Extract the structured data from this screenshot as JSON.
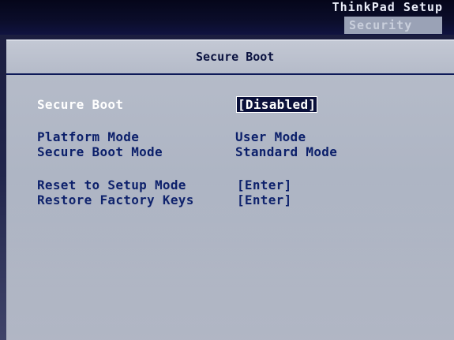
{
  "header": {
    "app_title": "ThinkPad Setup",
    "active_tab": "Security"
  },
  "panel": {
    "title": "Secure Boot",
    "items": [
      {
        "label": "Secure Boot",
        "value": "[Disabled]",
        "selected": true
      },
      {
        "label": "Platform Mode",
        "value": "User Mode",
        "selected": false
      },
      {
        "label": "Secure Boot Mode",
        "value": "Standard Mode",
        "selected": false
      },
      {
        "label": "Reset to Setup Mode",
        "value": "[Enter]",
        "selected": false
      },
      {
        "label": "Restore Factory Keys",
        "value": "[Enter]",
        "selected": false
      }
    ]
  },
  "colors": {
    "topbar": "#0b0d2a",
    "panel_bg": "#b0b6c5",
    "text_blue": "#0b1f6a",
    "highlight_bg": "#0a103a",
    "highlight_text": "#ffffff",
    "tab_bg": "#9aa2b6"
  }
}
